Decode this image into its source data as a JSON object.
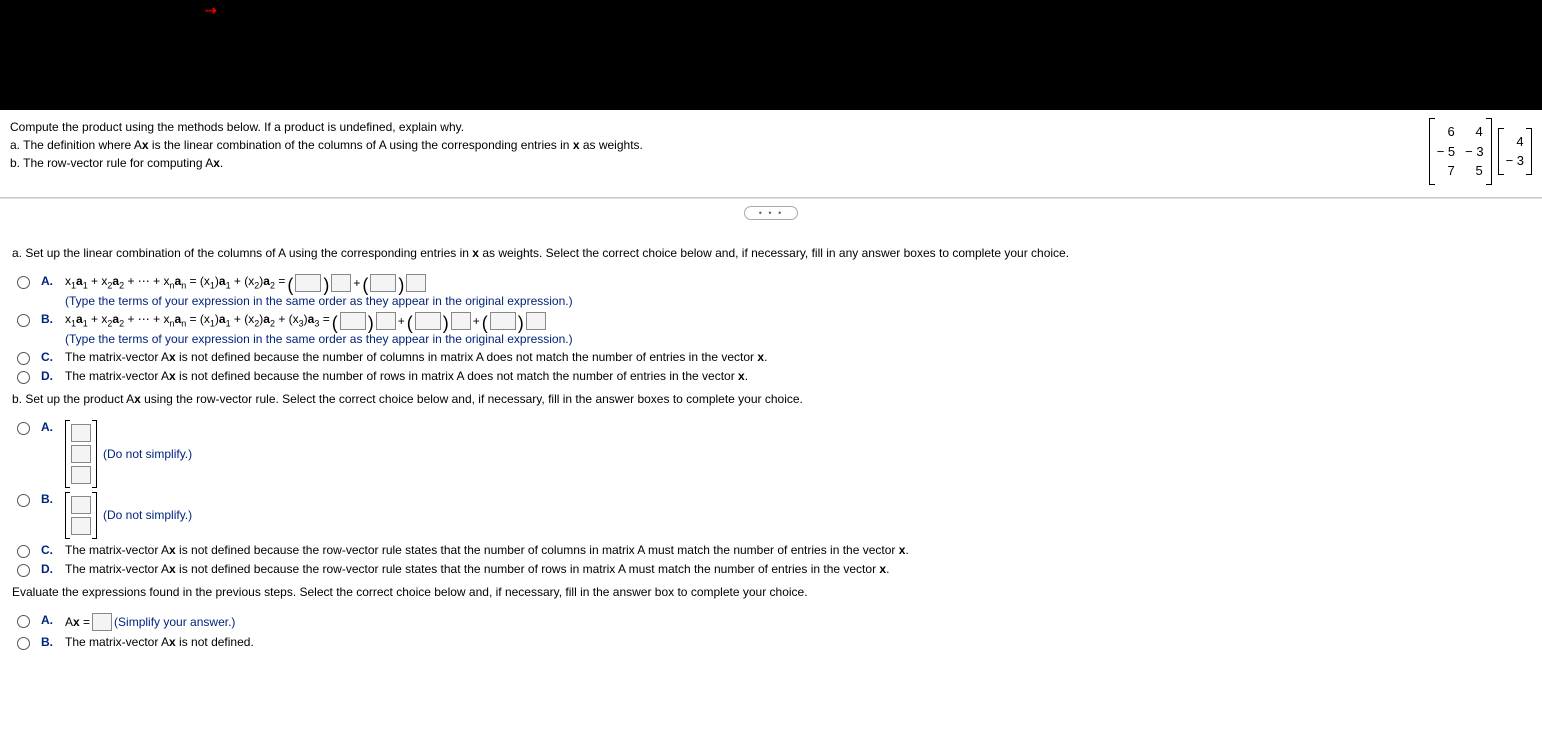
{
  "header": {
    "line1": "Compute the product using the methods below. If a product is undefined, explain why.",
    "line2_pre": "a. The definition where A",
    "line2_mid": " is the linear combination of the columns of A using the corresponding entries in ",
    "line2_post": " as weights.",
    "line3": "b. The row-vector rule for computing A",
    "bold_x": "x",
    "period": "."
  },
  "matrixA": {
    "r1c1": "6",
    "r1c2": "4",
    "r2c1": "− 5",
    "r2c2": "− 3",
    "r3c1": "7",
    "r3c2": "5"
  },
  "vectorX": {
    "r1": "4",
    "r2": "− 3"
  },
  "dots": "• • •",
  "partA": {
    "prompt_pre": "a. Set up the linear combination of the columns of A using the corresponding entries in ",
    "prompt_post": " as weights. Select the correct choice below and, if necessary, fill in any answer boxes to complete your choice.",
    "optA": {
      "label": "A.",
      "expr_lhs": "x₁a₁ + x₂a₂ + ⋯ + xₙaₙ = (x₁)a₁ + (x₂)a₂ = ",
      "hint": "(Type the terms of your expression in the same order as they appear in the original expression.)"
    },
    "optB": {
      "label": "B.",
      "expr_lhs": "x₁a₁ + x₂a₂ + ⋯ + xₙaₙ = (x₁)a₁ + (x₂)a₂ + (x₃)a₃ = ",
      "hint": "(Type the terms of your expression in the same order as they appear in the original expression.)"
    },
    "optC": {
      "label": "C.",
      "text_pre": "The matrix-vector A",
      "text_post": " is not defined because the number of columns in matrix A does not match the number of entries in the vector "
    },
    "optD": {
      "label": "D.",
      "text_pre": "The matrix-vector A",
      "text_post": " is not defined because the number of rows in matrix A does not match the number of entries in the vector "
    }
  },
  "partB": {
    "prompt_pre": "b. Set up the product A",
    "prompt_post": " using the row-vector rule. Select the correct choice below and, if necessary, fill in the answer boxes to complete your choice.",
    "optA": {
      "label": "A.",
      "hint": "(Do not simplify.)"
    },
    "optB": {
      "label": "B.",
      "hint": "(Do not simplify.)"
    },
    "optC": {
      "label": "C.",
      "text_pre": "The matrix-vector A",
      "text_post": " is not defined because the row-vector rule states that the number of columns in matrix A must match the number of entries in the vector "
    },
    "optD": {
      "label": "D.",
      "text_pre": "The matrix-vector A",
      "text_post": " is not defined because the row-vector rule states that the number of rows in matrix A must match the number of entries in the vector "
    }
  },
  "eval": {
    "prompt": "Evaluate the expressions found in the previous steps. Select the correct choice below and, if necessary, fill in the answer box to complete your choice.",
    "optA": {
      "label": "A.",
      "lhs": "Ax = ",
      "hint": "(Simplify your answer.)"
    },
    "optB": {
      "label": "B.",
      "text_pre": "The matrix-vector A",
      "text_post": " is not defined."
    }
  },
  "plus": "+"
}
